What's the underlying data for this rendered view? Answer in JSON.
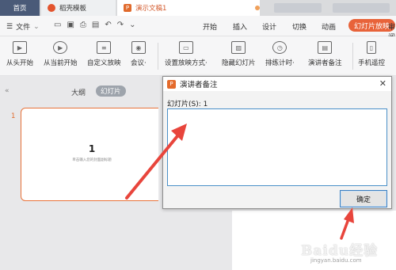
{
  "tabs": {
    "home": "首页",
    "template": "稻壳模板",
    "document": "演示文稿1"
  },
  "menubar": {
    "file": "文件",
    "items": [
      "开始",
      "插入",
      "设计",
      "切换",
      "动画"
    ],
    "active": "幻灯片放映",
    "overflow": "审阅"
  },
  "ribbon": {
    "buttons": [
      {
        "label": "从头开始",
        "icon": "play-from-start-icon"
      },
      {
        "label": "从当前开始",
        "icon": "play-current-icon"
      },
      {
        "label": "自定义放映",
        "icon": "custom-show-icon"
      },
      {
        "label": "会议·",
        "icon": "meeting-icon"
      },
      {
        "label": "设置放映方式·",
        "icon": "setup-show-icon"
      },
      {
        "label": "隐藏幻灯片",
        "icon": "hide-slide-icon"
      },
      {
        "label": "排练计时·",
        "icon": "rehearse-timer-icon"
      },
      {
        "label": "演讲者备注",
        "icon": "speaker-notes-icon"
      },
      {
        "label": "手机遥控",
        "icon": "phone-remote-icon"
      }
    ]
  },
  "leftpanel": {
    "outline": "大纲",
    "slides": "幻灯片",
    "slide_number": "1",
    "thumb_number": "1",
    "thumb_subtitle": "单击输入您的封面副标题"
  },
  "dialog": {
    "title": "演讲者备注",
    "close": "✕",
    "label": "幻灯片(S): 1",
    "ok": "确定"
  },
  "watermark": {
    "main": "Baidu经验",
    "url": "jingyan.baidu.com"
  },
  "colors": {
    "accent": "#e8633a",
    "annotation_arrow": "#e8453c"
  }
}
